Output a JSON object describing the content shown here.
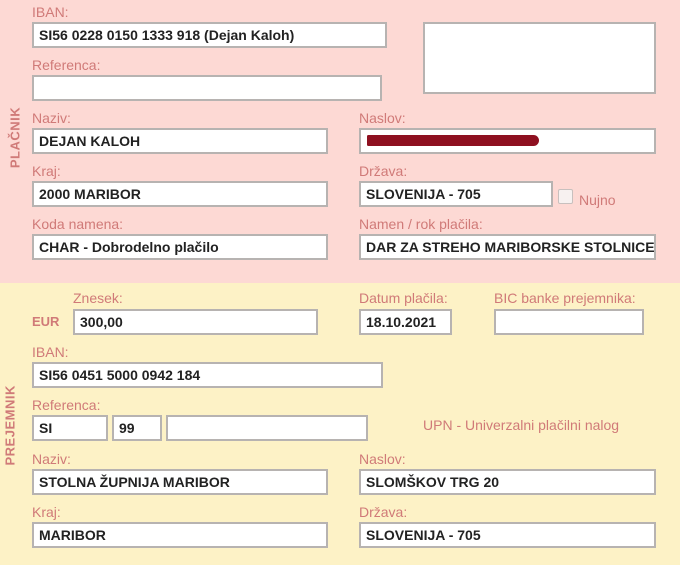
{
  "colors": {
    "payer_bg": "#fdd9d4",
    "payee_bg": "#fdf2c6",
    "label": "#d07a78",
    "field_border": "#b7b3b1",
    "redaction": "#8e1020"
  },
  "payer": {
    "section_label": "PLAČNIK",
    "iban_label": "IBAN:",
    "iban_value": "SI56 0228 0150 1333 918 (Dejan Kaloh)",
    "reference_label": "Referenca:",
    "reference_value": "",
    "name_label": "Naziv:",
    "name_value": "DEJAN KALOH",
    "address_label": "Naslov:",
    "city_label": "Kraj:",
    "city_value": "2000 MARIBOR",
    "country_label": "Država:",
    "country_value": "SLOVENIJA - 705",
    "urgent_label": "Nujno",
    "urgent_checked": false,
    "purpose_code_label": "Koda namena:",
    "purpose_code_value": "CHAR - Dobrodelno plačilo",
    "purpose_label": "Namen / rok plačila:",
    "purpose_value": "DAR ZA STREHO MARIBORSKE STOLNICE"
  },
  "payee": {
    "section_label": "PREJEMNIK",
    "currency": "EUR",
    "amount_label": "Znesek:",
    "amount_value": "300,00",
    "date_label": "Datum plačila:",
    "date_value": "18.10.2021",
    "bic_label": "BIC banke prejemnika:",
    "bic_value": "",
    "iban_label": "IBAN:",
    "iban_value": "SI56 0451 5000 0942 184",
    "reference_label": "Referenca:",
    "reference_model": "SI",
    "reference_check": "99",
    "reference_number": "",
    "form_name": "UPN - Univerzalni plačilni nalog",
    "name_label": "Naziv:",
    "name_value": "STOLNA ŽUPNIJA MARIBOR",
    "address_label": "Naslov:",
    "address_value": "SLOMŠKOV TRG 20",
    "city_label": "Kraj:",
    "city_value": "MARIBOR",
    "country_label": "Država:",
    "country_value": "SLOVENIJA - 705"
  }
}
